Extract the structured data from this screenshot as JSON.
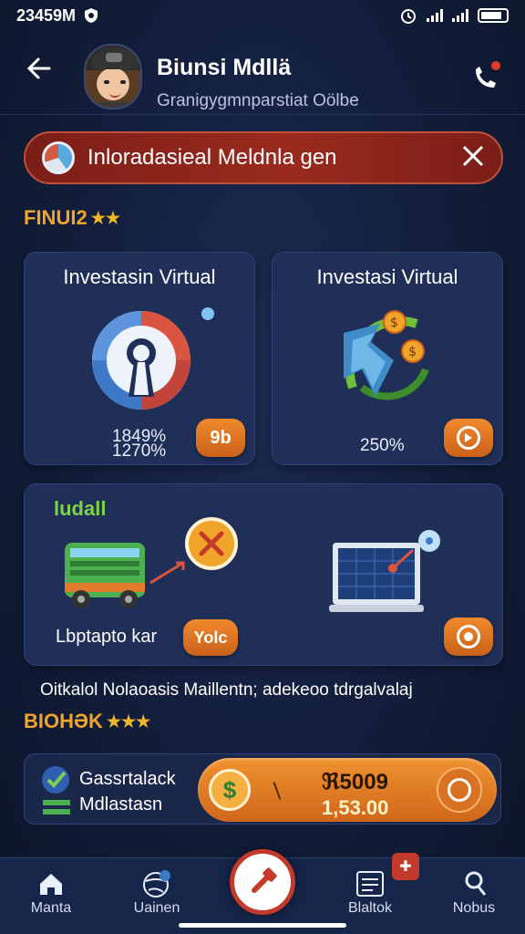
{
  "status_bar": {
    "time": "23459M"
  },
  "header": {
    "name": "Biunsi Mdllä",
    "subtitle": "Granigygmnparstiat Oölbe"
  },
  "alert": {
    "text": "Inloradasieal Meldnla gen"
  },
  "section1": {
    "title": "FINUI2"
  },
  "cards": [
    {
      "title": "Investasin Virtual",
      "pct_line1": "1849%",
      "pct_line2": "1270%",
      "button": "9b"
    },
    {
      "title": "Investasi Virtual",
      "pct_line1": "250%",
      "pct_line2": "",
      "button": ""
    }
  ],
  "wide_card": {
    "title": "ludall",
    "label": "Lbptapto kar",
    "button": "Yolc"
  },
  "caption": "Oitkalol Nolaoasis Maillentn; adekeoo tdrgalvalaj",
  "section2": {
    "title": "BIOHƏK"
  },
  "balance": {
    "line1": "Gassrtalack",
    "line2": "Mdlastasn",
    "amount": "ℜ5009",
    "amount2": "1,53.00"
  },
  "tabs": [
    {
      "label": "Manta",
      "icon": "home-icon"
    },
    {
      "label": "Uainen",
      "icon": "globe-icon"
    },
    {
      "label": "Blaltok",
      "icon": "list-icon"
    },
    {
      "label": "Nobus",
      "icon": "user-icon"
    }
  ],
  "colors": {
    "accent_orange": "#f0922f",
    "alert_red": "#9a2a1e",
    "section_gold": "#f0a52a",
    "card_bg": "#1f2f58"
  }
}
